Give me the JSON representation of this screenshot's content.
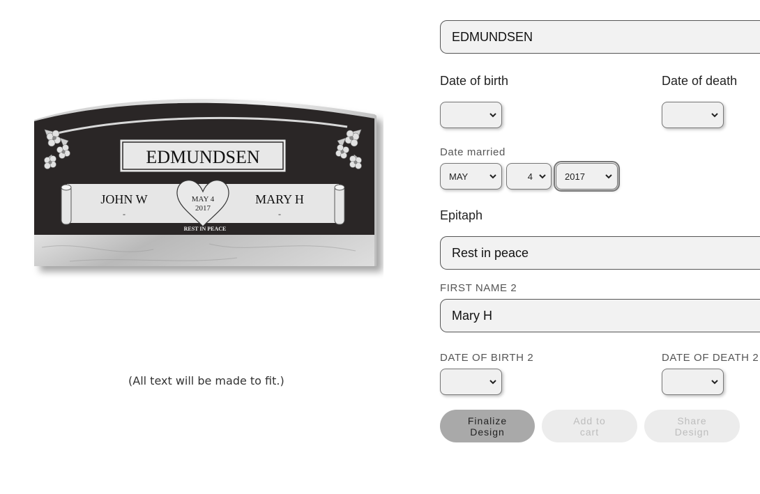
{
  "preview": {
    "surname": "EDMUNDSEN",
    "left_name": "JOHN W",
    "left_dates": "-",
    "right_name": "MARY H",
    "right_dates": "-",
    "heart_line1": "MAY 4",
    "heart_line2": "2017",
    "epitaph": "REST IN PEACE",
    "fit_note": "(All text will be made to fit.)"
  },
  "form": {
    "surname_value": "EDMUNDSEN",
    "date_of_birth_label": "Date of birth",
    "date_of_death_label": "Date of death",
    "date_married_label": "Date married",
    "married_month": "MAY",
    "married_day": "4",
    "married_year": "2017",
    "epitaph_label": "Epitaph",
    "epitaph_value": "Rest in peace",
    "first_name_2_label": "FIRST NAME 2",
    "first_name_2_value": "Mary H",
    "date_of_birth_2_label": "DATE OF BIRTH 2",
    "date_of_death_2_label": "DATE OF DEATH 2"
  },
  "buttons": {
    "finalize_line1": "Finalize",
    "finalize_line2": "Design",
    "add_cart_line1": "Add to",
    "add_cart_line2": "cart",
    "share_line1": "Share",
    "share_line2": "Design"
  },
  "colors": {
    "granite": "#2a2828",
    "panel": "#e8e8e8",
    "primary_button": "#a9a9a9",
    "disabled_button": "#ececec"
  },
  "icons": [
    "chevron-down-icon",
    "flower-icon",
    "scroll-icon",
    "heart-icon"
  ]
}
